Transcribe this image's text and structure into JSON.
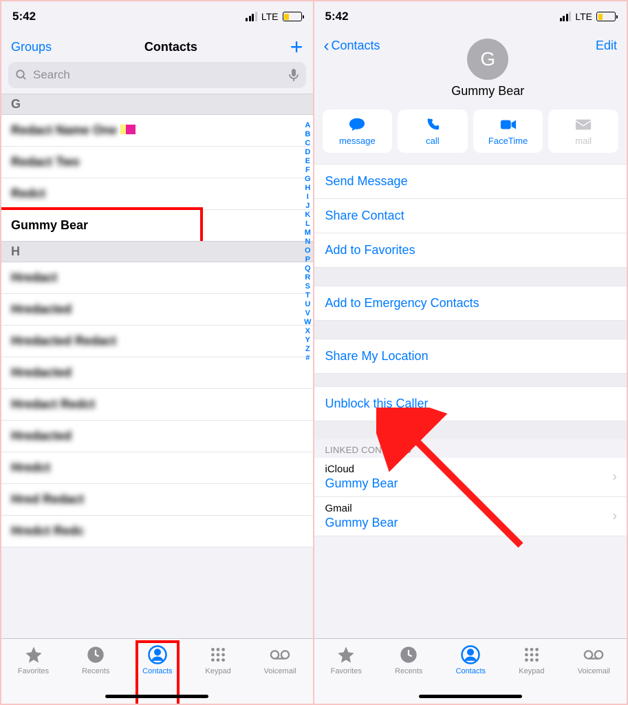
{
  "status": {
    "time": "5:42",
    "network": "LTE"
  },
  "left": {
    "groups": "Groups",
    "title": "Contacts",
    "search_placeholder": "Search",
    "sections": {
      "g": "G",
      "h": "H",
      "gummy": "Gummy Bear"
    },
    "index": [
      "A",
      "B",
      "C",
      "D",
      "E",
      "F",
      "G",
      "H",
      "I",
      "J",
      "K",
      "L",
      "M",
      "N",
      "O",
      "P",
      "Q",
      "R",
      "S",
      "T",
      "U",
      "V",
      "W",
      "X",
      "Y",
      "Z",
      "#"
    ]
  },
  "tabs": {
    "favorites": "Favorites",
    "recents": "Recents",
    "contacts": "Contacts",
    "keypad": "Keypad",
    "voicemail": "Voicemail"
  },
  "right": {
    "back": "Contacts",
    "edit": "Edit",
    "avatar_letter": "G",
    "name": "Gummy Bear",
    "actions": {
      "message": "message",
      "call": "call",
      "facetime": "FaceTime",
      "mail": "mail"
    },
    "cells": {
      "send": "Send Message",
      "share": "Share Contact",
      "fav": "Add to Favorites",
      "emergency": "Add to Emergency Contacts",
      "location": "Share My Location",
      "unblock": "Unblock this Caller"
    },
    "linked_header": "LINKED CONTACTS",
    "linked": [
      {
        "source": "iCloud",
        "name": "Gummy Bear"
      },
      {
        "source": "Gmail",
        "name": "Gummy Bear"
      }
    ]
  }
}
